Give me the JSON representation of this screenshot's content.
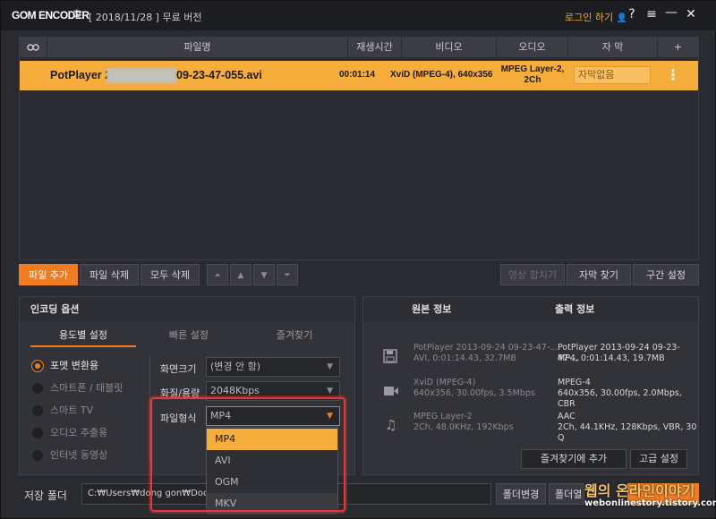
{
  "titlebar": {
    "logo": "GOM ENCODER",
    "version": "[ 2018/11/28 ] 무료 버전",
    "login": "로그인 하기",
    "icons": [
      "gear-icon",
      "user-icon",
      "help-icon",
      "menu-icon",
      "minimize-icon",
      "close-icon"
    ],
    "help_glyph": "?",
    "menu_glyph": "≡",
    "min_glyph": "—",
    "close_glyph": "✕"
  },
  "file_list": {
    "columns": [
      "파일명",
      "재생시간",
      "비디오",
      "오디오",
      "자 막",
      "+"
    ],
    "row": {
      "filename_start": "PotPlayer 20",
      "filename_end": "09-23-47-055.avi",
      "duration": "00:01:14",
      "video": "XviD (MPEG-4), 640x356",
      "audio_line1": "MPEG Layer-2,",
      "audio_line2": "2Ch",
      "subtitle": "자막없음",
      "more": "⋮"
    }
  },
  "toolbar": {
    "add_file": "파일 추가",
    "delete_file": "파일 삭제",
    "delete_all": "모두 삭제",
    "move_top": "⏶",
    "move_up": "▲",
    "move_down": "▼",
    "move_bottom": "⏷",
    "merge_video": "영상 합치기",
    "find_subtitle": "자막 찾기",
    "section_setting": "구간 설정"
  },
  "options": {
    "title": "인코딩 옵션",
    "tabs": [
      "용도별 설정",
      "빠른 설정",
      "즐겨찾기"
    ],
    "radios": [
      {
        "label": "포맷 변환용",
        "selected": true
      },
      {
        "label": "스마트폰 / 태블릿",
        "selected": false
      },
      {
        "label": "스마트 TV",
        "selected": false
      },
      {
        "label": "오디오 추출용",
        "selected": false
      },
      {
        "label": "인터넷 동영상",
        "selected": false
      }
    ],
    "screen_size_label": "화면크기",
    "screen_size_value": "(변경 안 함)",
    "quality_label": "화질/용량",
    "quality_value": "2048Kbps",
    "format_label": "파일형식",
    "format_value": "MP4",
    "format_options": [
      "MP4",
      "AVI",
      "OGM",
      "MKV"
    ]
  },
  "info": {
    "source_title": "원본 정보",
    "output_title": "출력 정보",
    "file_src_1": "PotPlayer 2013-09-24 09-23-47-...",
    "file_src_2": "AVI, 0:01:14.43, 32.7MB",
    "file_out_1": "PotPlayer 2013-09-24 09-23-47-...",
    "file_out_2": "MP4, 0:01:14.43, 19.7MB",
    "video_src_1": "XviD (MPEG-4)",
    "video_src_2": "640x356, 30.00fps, 3.5Mbps",
    "video_out_1": "MPEG-4",
    "video_out_2": "640x356, 30.00fps, 2.0Mbps, CBR",
    "audio_src_1": "MPEG Layer-2",
    "audio_src_2": "2Ch, 48.0KHz, 192Kbps",
    "audio_out_1": "AAC",
    "audio_out_2": "2Ch, 44.1KHz, 128Kbps, VBR, 30 Q",
    "add_favorite": "즐겨찾기에 추가",
    "advanced": "고급 설정"
  },
  "bottom": {
    "save_label": "저장 폴더",
    "path": "C:₩Users₩dong   gon₩Documen",
    "change_folder": "폴더변경",
    "open_folder": "폴더열"
  },
  "watermark": {
    "line1": "웹의 온라인이야기",
    "line2": "webonlinestory.tistory.com"
  },
  "colors": {
    "accent": "#f07c22",
    "row_highlight": "#f5ad3c",
    "red_frame": "#e8383a"
  }
}
